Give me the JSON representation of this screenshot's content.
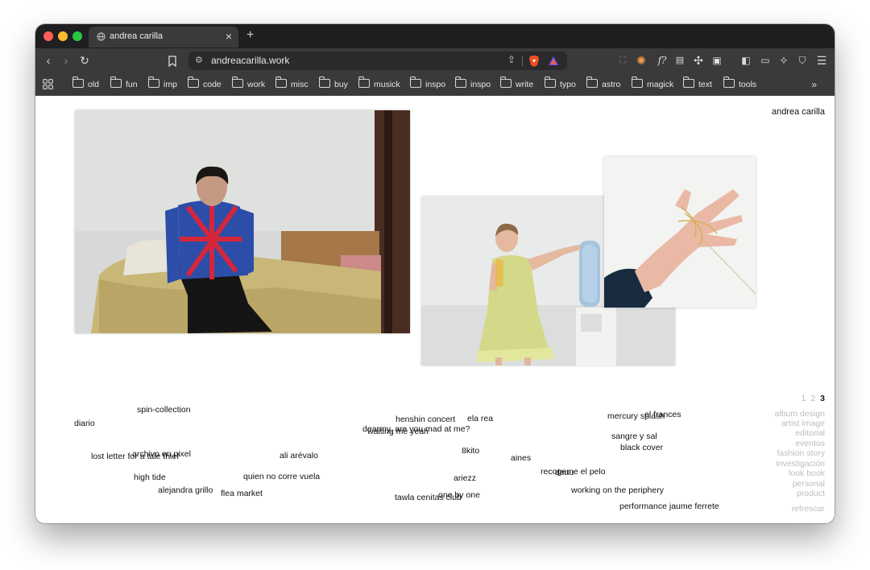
{
  "browser": {
    "tab_title": "andrea carilla",
    "url": "andreacarilla.work",
    "bookmarks": [
      "old",
      "fun",
      "imp",
      "code",
      "work",
      "misc",
      "buy",
      "musick",
      "inspo",
      "inspo",
      "write",
      "typo",
      "astro",
      "magick",
      "text",
      "tools"
    ]
  },
  "site": {
    "title": "andrea carilla",
    "pages": [
      "1",
      "2",
      "3"
    ],
    "current_page": "3",
    "categories": [
      "album design",
      "artist image",
      "editorial",
      "eventos",
      "fashion story",
      "investigación",
      "look book",
      "personal",
      "product"
    ],
    "refresh": "refrescar",
    "projects": [
      "spin-collection",
      "diario",
      "henshin concert",
      "ela rea",
      "dearmy, are you mad at me?",
      "waiting me yeah",
      "mercury splash",
      "el frances",
      "sangre y sal",
      "black cover",
      "8kito",
      "aines",
      "archivo en pixel",
      "lost letter for a tale thief",
      "ali arévalo",
      "recogeme el pelo",
      "deuu",
      "high tide",
      "quien no corre vuela",
      "ariezz",
      "alejandra grillo",
      "flea market",
      "working on the periphery",
      "one by one",
      "tawla cenitas club",
      "performance jaume ferrete"
    ]
  },
  "colors": {
    "chrome_dark": "#1f1f22",
    "chrome": "#3a3a3d",
    "text_muted": "#bdbdbd"
  }
}
